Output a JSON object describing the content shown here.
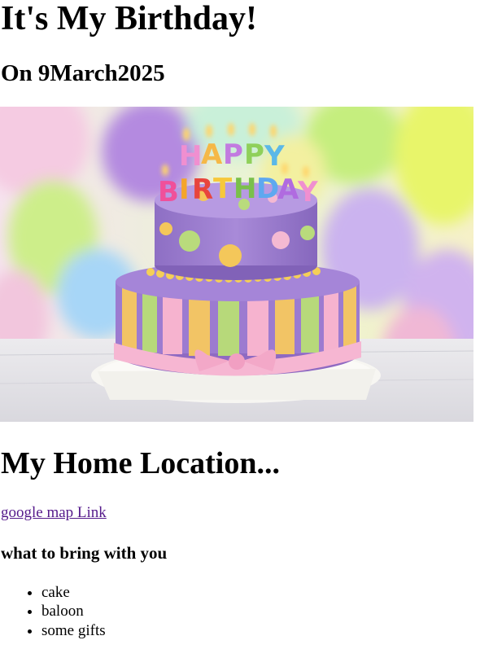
{
  "header": {
    "title": "It's My Birthday!",
    "date": "On 9March2025"
  },
  "photo": {
    "description": "birthday-cake-photo",
    "candle_text_top": "HAPPY",
    "candle_text_bottom": "BIRTHDAY"
  },
  "location": {
    "heading": "My Home Location...",
    "link_text": "google map Link",
    "link_color": "#551a8b"
  },
  "bring": {
    "heading": "what to bring with you",
    "items": [
      {
        "label": "cake"
      },
      {
        "label": "baloon"
      },
      {
        "label": "some gifts"
      }
    ]
  }
}
